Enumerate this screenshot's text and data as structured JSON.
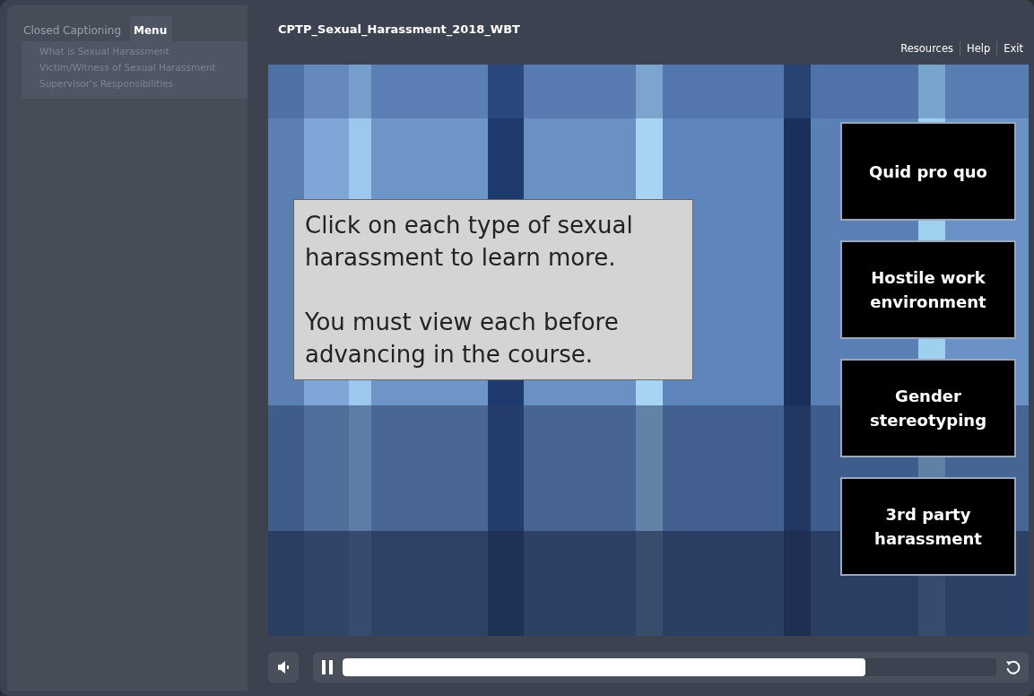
{
  "sidebar": {
    "tabs": [
      {
        "label": "Closed Captioning",
        "selected": false
      },
      {
        "label": "Menu",
        "selected": true
      }
    ],
    "items": [
      {
        "label": "What is Sexual Harassment"
      },
      {
        "label": "Victim/Witness of Sexual Harassment"
      },
      {
        "label": "Supervisor's Responsibilities"
      }
    ]
  },
  "header": {
    "title": "CPTP_Sexual_Harassment_2018_WBT",
    "links": [
      "Resources",
      "Help",
      "Exit"
    ]
  },
  "slide": {
    "instruction": [
      "Click on each type of sexual harassment to learn more.",
      "You must view each before advancing in the course."
    ],
    "buttons": [
      "Quid pro quo",
      "Hostile work environment",
      "Gender stereotyping",
      "3rd party harassment"
    ]
  },
  "player": {
    "playing": true,
    "progress": {
      "level": 0.8
    }
  }
}
